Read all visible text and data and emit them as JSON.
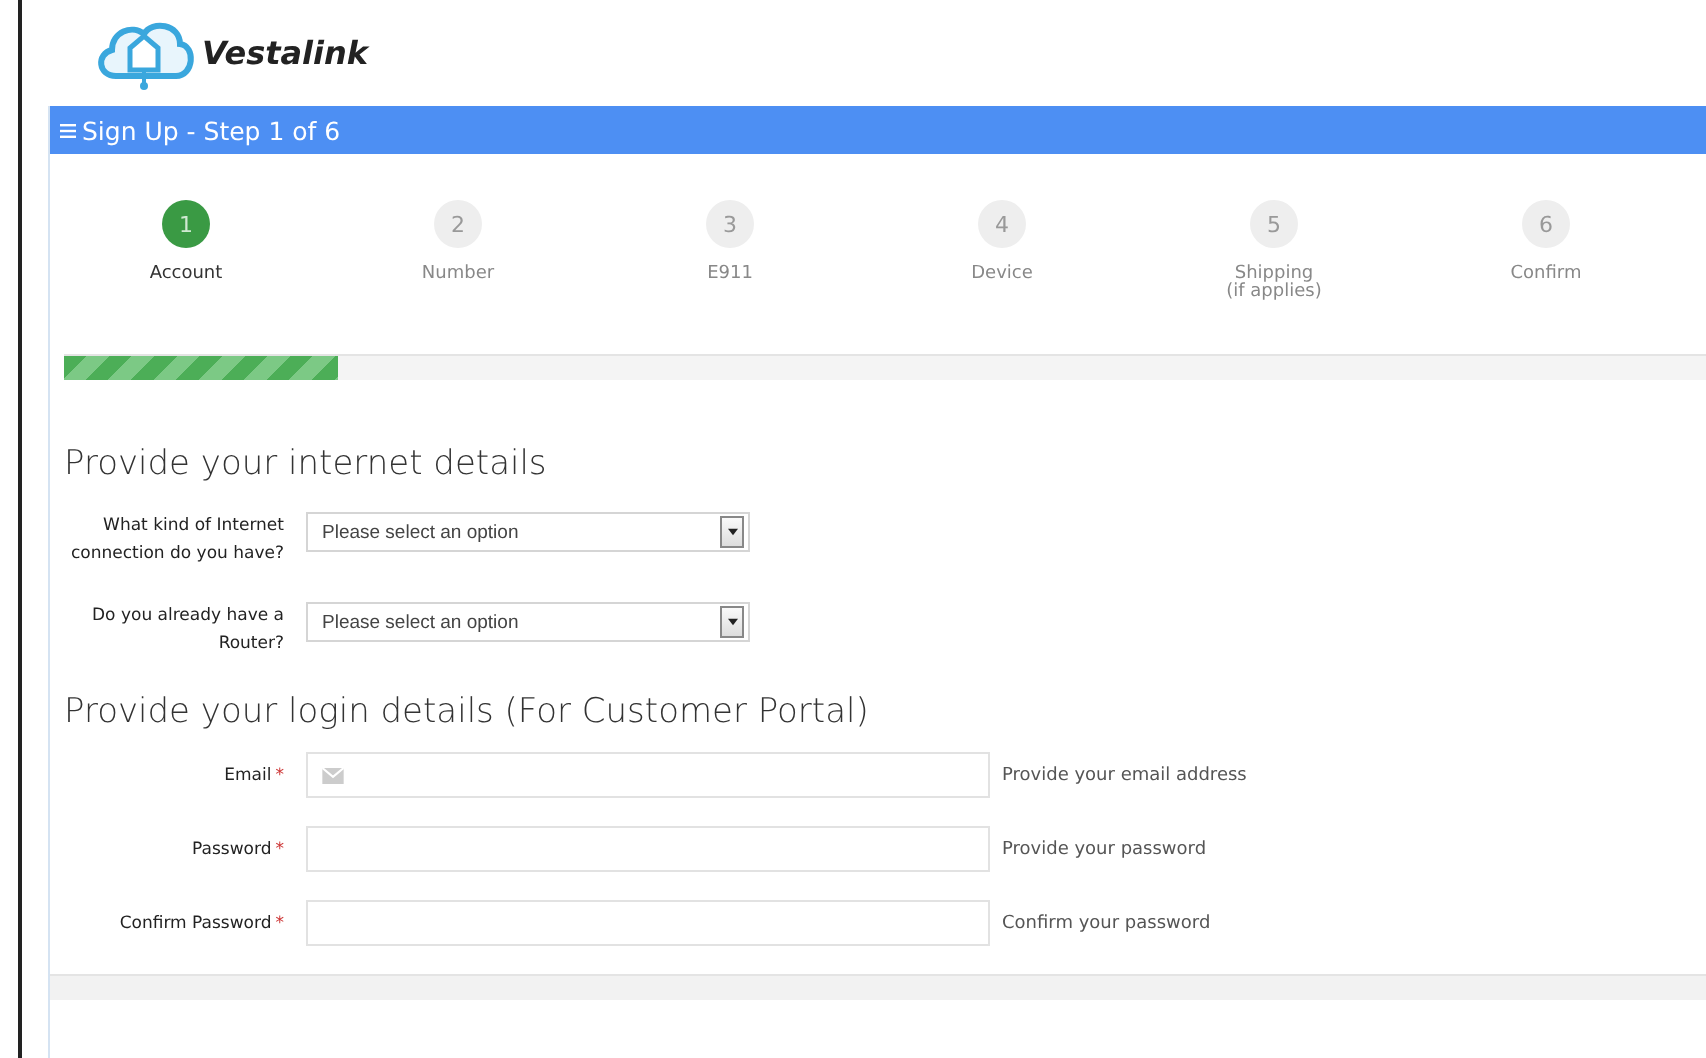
{
  "logo": {
    "text": "Vestalink"
  },
  "header": {
    "title": "Sign Up - Step 1 of 6"
  },
  "steps": [
    {
      "number": "1",
      "label": "Account",
      "selected": true
    },
    {
      "number": "2",
      "label": "Number",
      "selected": false
    },
    {
      "number": "3",
      "label": "E911",
      "selected": false
    },
    {
      "number": "4",
      "label": "Device",
      "selected": false
    },
    {
      "number": "5",
      "label": "Shipping",
      "note": "(if applies)",
      "selected": false
    },
    {
      "number": "6",
      "label": "Confirm",
      "selected": false
    }
  ],
  "progress": {
    "level": 0.167
  },
  "sections": [
    {
      "title": "Provide your internet details",
      "fields": [
        {
          "kind": "select",
          "label": "What kind of Internet connection do you have?",
          "placeholder": "Please select an option"
        },
        {
          "kind": "select",
          "label": "Do you already have a Router?",
          "placeholder": "Please select an option"
        }
      ]
    },
    {
      "title": "Provide your login details (For Customer Portal)",
      "fields": [
        {
          "kind": "email",
          "label": "Email",
          "required_mark": "*",
          "help": "Provide your email address"
        },
        {
          "kind": "password",
          "label": "Password",
          "required_mark": "*",
          "help": "Provide your password"
        },
        {
          "kind": "password",
          "label": "Confirm Password",
          "required_mark": "*",
          "help": "Confirm your password"
        }
      ]
    }
  ]
}
